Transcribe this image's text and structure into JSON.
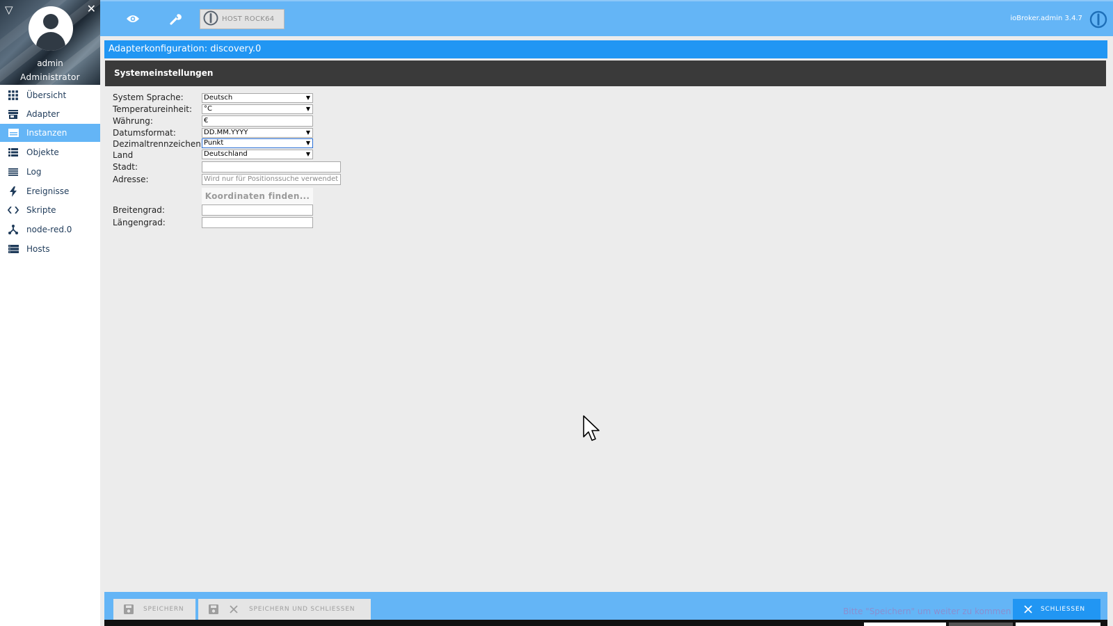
{
  "user": {
    "name": "admin",
    "role": "Administrator"
  },
  "sidebar": {
    "items": [
      {
        "label": "Übersicht",
        "icon": "grid-icon",
        "active": false
      },
      {
        "label": "Adapter",
        "icon": "store-icon",
        "active": false
      },
      {
        "label": "Instanzen",
        "icon": "instances-icon",
        "active": true
      },
      {
        "label": "Objekte",
        "icon": "list-icon",
        "active": false
      },
      {
        "label": "Log",
        "icon": "log-icon",
        "active": false
      },
      {
        "label": "Ereignisse",
        "icon": "bolt-icon",
        "active": false
      },
      {
        "label": "Skripte",
        "icon": "code-icon",
        "active": false
      },
      {
        "label": "node-red.0",
        "icon": "node-red-icon",
        "active": false
      },
      {
        "label": "Hosts",
        "icon": "hosts-icon",
        "active": false
      }
    ]
  },
  "topbar": {
    "icons": [
      "eye-icon",
      "wrench-icon"
    ],
    "host_label": "HOST ROCK64",
    "version": "ioBroker.admin 3.4.7"
  },
  "content": {
    "title": "Adapterkonfiguration: discovery.0",
    "section": "Systemeinstellungen"
  },
  "form": {
    "system_language": {
      "label": "System Sprache:",
      "value": "Deutsch"
    },
    "temperature_unit": {
      "label": "Temperatureinheit:",
      "value": "°C"
    },
    "currency": {
      "label": "Währung:",
      "value": "€"
    },
    "date_format": {
      "label": "Datumsformat:",
      "value": "DD.MM.YYYY"
    },
    "decimal_separator": {
      "label": "Dezimaltrennzeichen:",
      "value": "Punkt"
    },
    "country": {
      "label": "Land",
      "value": "Deutschland"
    },
    "city": {
      "label": "Stadt:",
      "value": ""
    },
    "address": {
      "label": "Adresse:",
      "value": "",
      "placeholder": "Wird nur für Positionssuche verwendet"
    },
    "find_coordinates_label": "Koordinaten finden...",
    "latitude": {
      "label": "Breitengrad:",
      "value": ""
    },
    "longitude": {
      "label": "Längengrad:",
      "value": ""
    }
  },
  "bottombar": {
    "save_label": "SPEICHERN",
    "save_close_label": "SPEICHERN UND SCHLIESSEN",
    "hint": "Bitte \"Speichern\" um weiter zu kommen",
    "close_label": "SCHLIESSEN"
  },
  "colors": {
    "topbar": "#64b5f6",
    "title_bar": "#2196f3",
    "section_header": "#3a3a3a",
    "active_nav": "#64b5f6"
  }
}
